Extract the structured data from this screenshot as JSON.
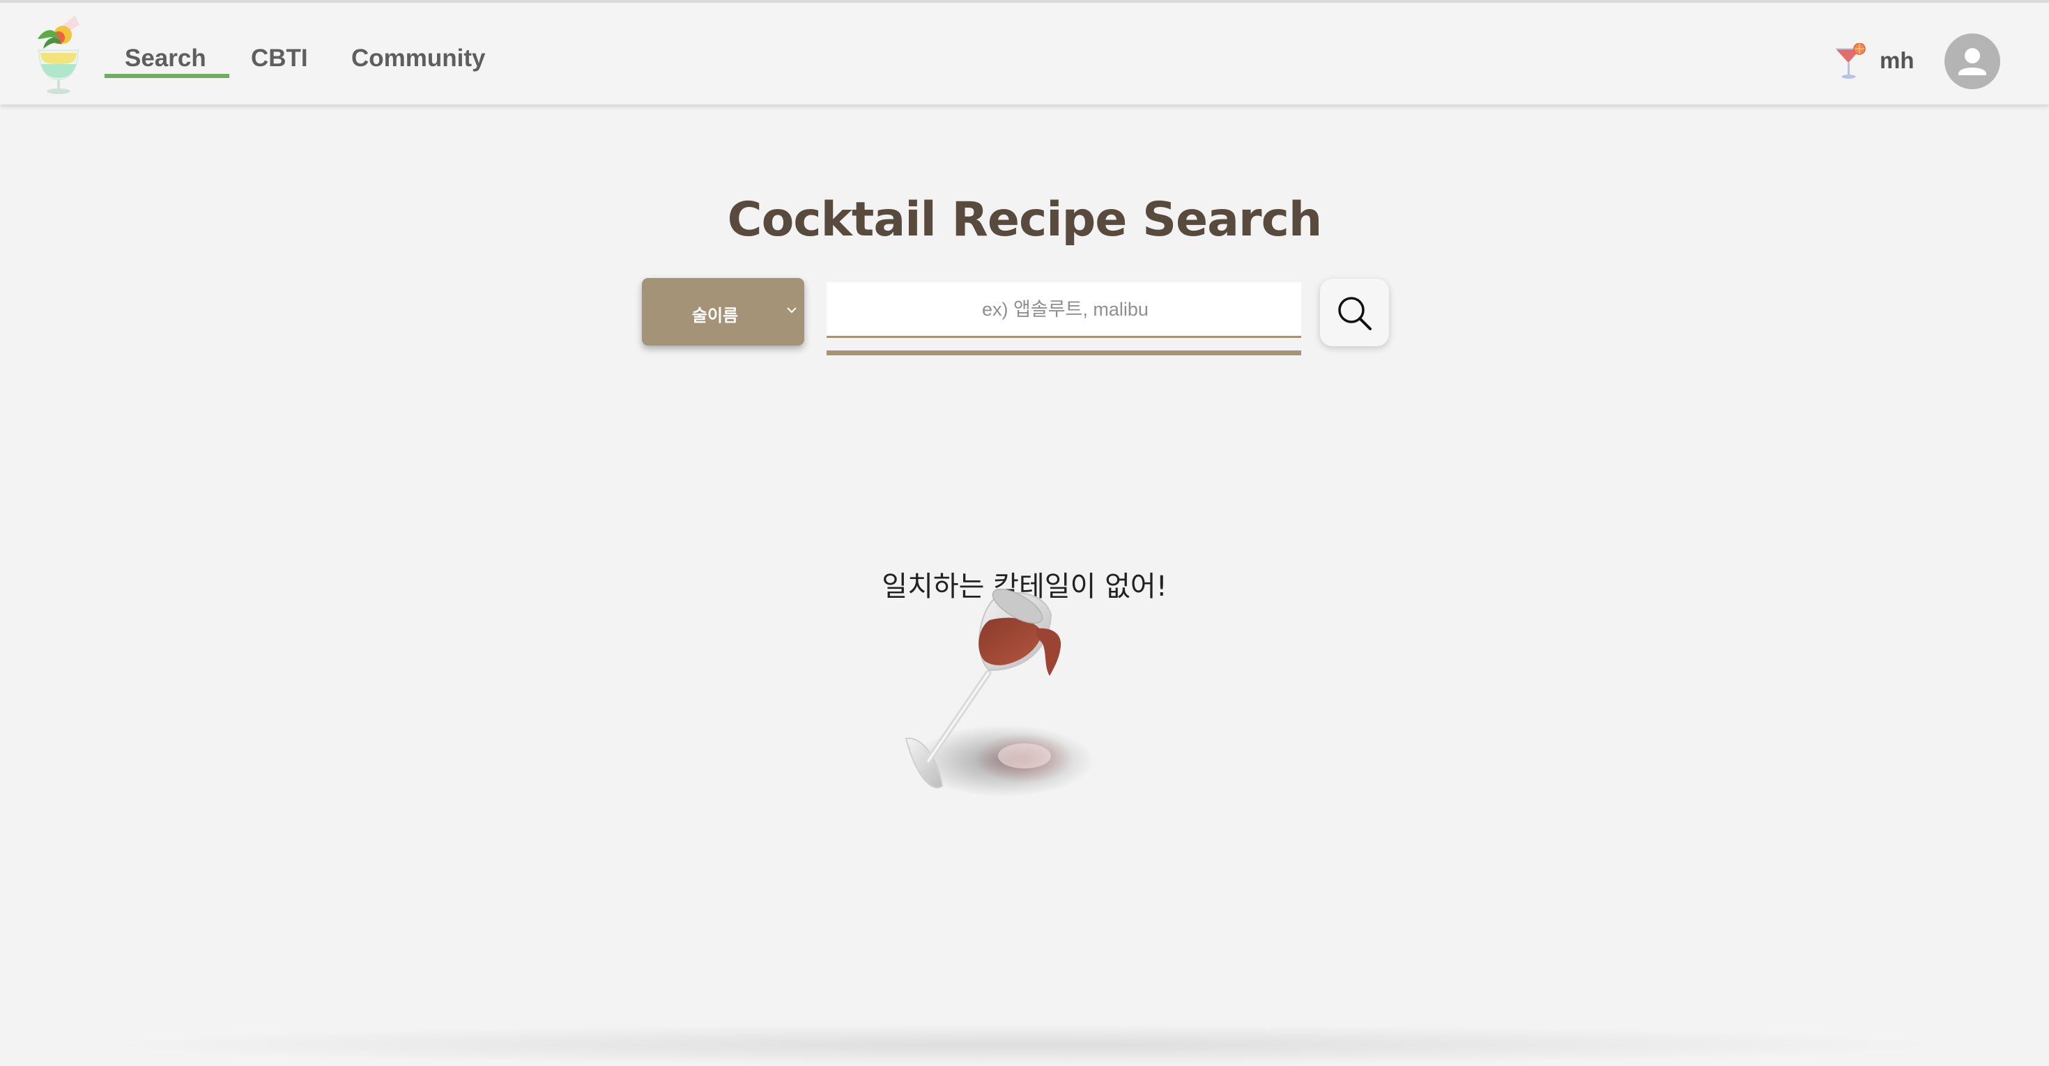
{
  "header": {
    "nav": [
      {
        "label": "Search",
        "active": true
      },
      {
        "label": "CBTI",
        "active": false
      },
      {
        "label": "Community",
        "active": false
      }
    ],
    "user": {
      "name": "mh"
    },
    "icons": {
      "logo": "tropical-cocktail-logo",
      "user_badge": "cocktail-glass-icon",
      "avatar": "person-icon"
    }
  },
  "main": {
    "title": "Cocktail Recipe Search",
    "search": {
      "category_selected": "술이름",
      "placeholder": "ex) 앱솔루트, malibu",
      "value": "",
      "button_icon": "magnifier-icon"
    },
    "empty_state": {
      "message": "일치하는 칵테일이 없어!",
      "illustration": "tipped-wine-glass"
    }
  },
  "colors": {
    "background": "#f3f3f3",
    "nav_active_underline": "#6fae62",
    "title": "#594a3e",
    "accent": "#a49377"
  }
}
